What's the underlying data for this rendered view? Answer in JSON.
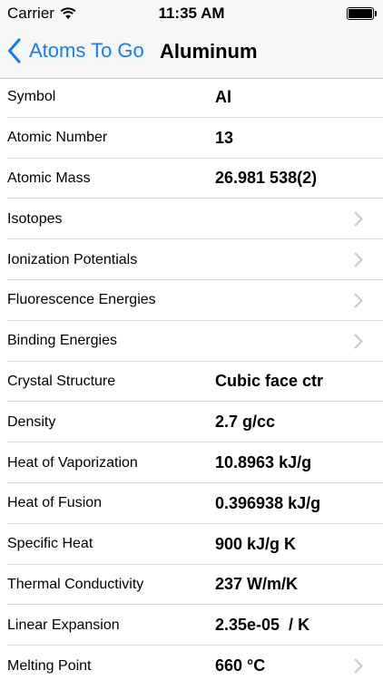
{
  "status_bar": {
    "carrier": "Carrier",
    "time": "11:35 AM"
  },
  "nav": {
    "back_label": "Atoms To Go",
    "title": "Aluminum"
  },
  "rows": [
    {
      "label": "Symbol",
      "value": "Al"
    },
    {
      "label": "Atomic Number",
      "value": "13"
    },
    {
      "label": "Atomic Mass",
      "value": "26.981 538(2)"
    },
    {
      "label": "Isotopes",
      "value": ""
    },
    {
      "label": "Ionization Potentials",
      "value": ""
    },
    {
      "label": "Fluorescence Energies",
      "value": ""
    },
    {
      "label": "Binding Energies",
      "value": ""
    },
    {
      "label": "Crystal Structure",
      "value": "Cubic face ctr"
    },
    {
      "label": "Density",
      "value": "2.7 g/cc"
    },
    {
      "label": "Heat of Vaporization",
      "value": "10.8963 kJ/g"
    },
    {
      "label": "Heat of Fusion",
      "value": "0.396938 kJ/g"
    },
    {
      "label": "Specific Heat",
      "value": "900 kJ/g K"
    },
    {
      "label": "Thermal Conductivity",
      "value": "237 W/m/K"
    },
    {
      "label": "Linear Expansion",
      "value": "2.35e-05  / K"
    },
    {
      "label": "Melting Point",
      "value": "660 °C"
    }
  ],
  "colors": {
    "accent": "#147efb",
    "separator": "#d8d8dc",
    "chevron": "#c7c7cc"
  }
}
